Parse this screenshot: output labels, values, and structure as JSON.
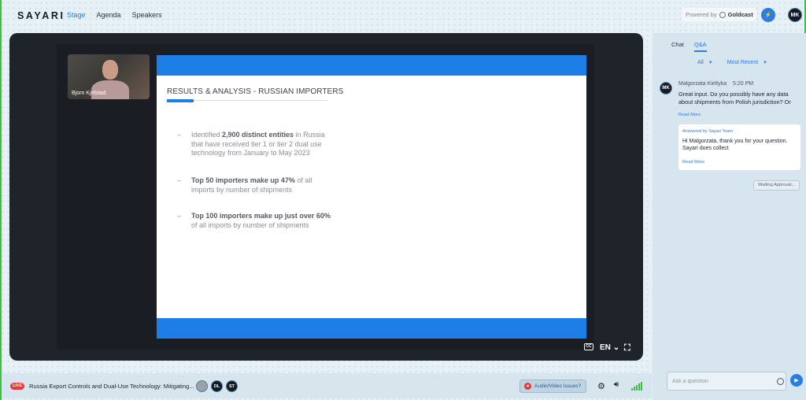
{
  "header": {
    "logo": "SAYARI",
    "nav": [
      "Stage",
      "Agenda",
      "Speakers"
    ],
    "powered_by": "Powered by",
    "powered_brand": "Goldcast",
    "user_initials": "MK"
  },
  "stage": {
    "speaker_name": "Bjorn Kjelstad",
    "slide": {
      "title": "RESULTS & ANALYSIS - RUSSIAN IMPORTERS",
      "bullets": [
        {
          "pre": "Identified ",
          "bold": "2,900 distinct entities",
          "post": " in Russia that have received tier 1 or tier 2 dual use technology from January to May 2023"
        },
        {
          "pre": "",
          "bold": "Top 50 importers make up 47%",
          "post": " of all imports by number of shipments"
        },
        {
          "pre": "",
          "bold": "Top 100 importers make up just over 60%",
          "post": " of all imports by number of shipments"
        }
      ],
      "dash": "–"
    },
    "controls": {
      "cc": "CC",
      "language": "EN",
      "expand_glyph": "⛶"
    }
  },
  "panel": {
    "tabs": [
      "Chat",
      "Q&A"
    ],
    "filter_all": "All",
    "filter_sort": "Most Recent",
    "question": {
      "avatar": "MK",
      "author": "Malgorzata Kieltyka",
      "time": "5:20 PM",
      "text": "Great input. Do you possibly have any data about shipments from Polish jurisdiction? Or",
      "read_more": "Read More"
    },
    "answer": {
      "by": "Answered by Sayari Team",
      "text": "Hi Malgorzata, thank you for your question.  Sayari does collect",
      "read_more": "Read More"
    },
    "status": "Waiting Approval...",
    "ask_placeholder": "Ask a question"
  },
  "bottom": {
    "live": "LIVE",
    "session_title": "Russia Export Controls and Dual-Use Technology: Mitigating...",
    "participants": [
      "",
      "DL",
      "ST"
    ],
    "av_issues": "Audio/Video Issues?"
  },
  "colors": {
    "accent": "#2b7de3",
    "slide_blue": "#1e7ee8",
    "live_red": "#e23b3b",
    "signal_green": "#3fbf3f"
  }
}
